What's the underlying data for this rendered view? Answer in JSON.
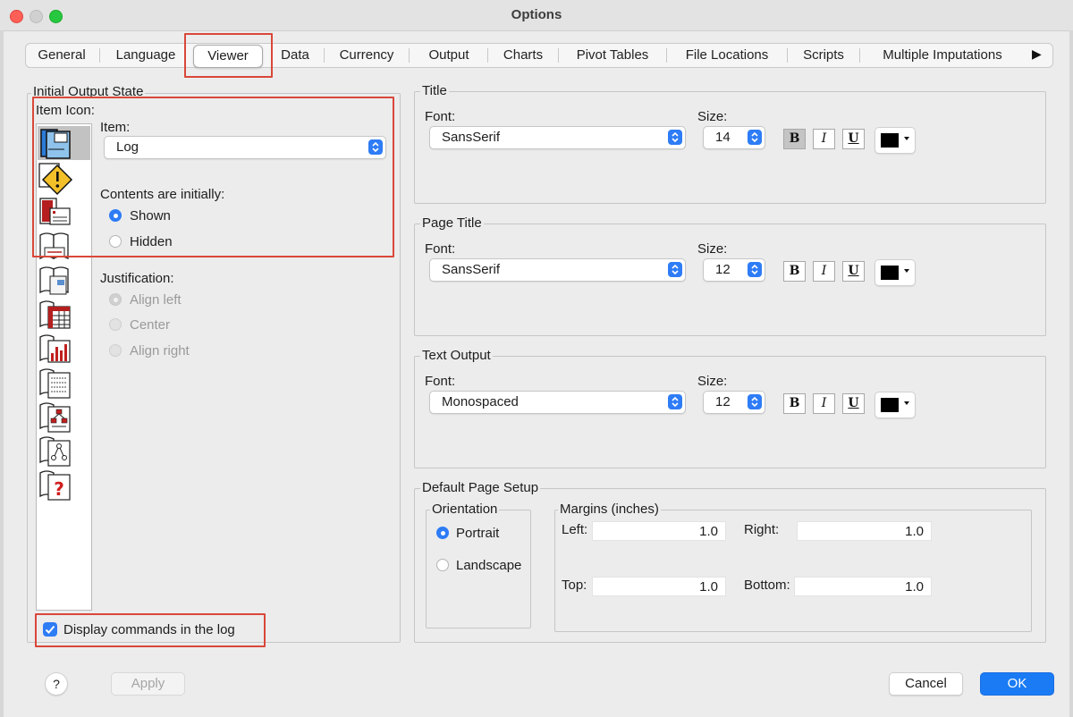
{
  "window": {
    "title": "Options"
  },
  "tabs": [
    "General",
    "Language",
    "Viewer",
    "Data",
    "Currency",
    "Output",
    "Charts",
    "Pivot Tables",
    "File Locations",
    "Scripts",
    "Multiple Imputations"
  ],
  "left": {
    "group_title": "Initial Output State",
    "item_icon_label": "Item Icon:",
    "item_label": "Item:",
    "item_value": "Log",
    "contents_label": "Contents are initially:",
    "shown": "Shown",
    "hidden": "Hidden",
    "justification_label": "Justification:",
    "align_left": "Align left",
    "center": "Center",
    "align_right": "Align right",
    "display_commands": "Display commands in the log",
    "icons": [
      "log-icon",
      "warning-icon",
      "notes-icon",
      "title-icon",
      "page-title-icon",
      "pivot-table-icon",
      "chart-icon",
      "text-output-icon",
      "tree-model-icon",
      "model-viewer-icon",
      "unknown-object-icon"
    ]
  },
  "title_section": {
    "label": "Title",
    "font_label": "Font:",
    "font": "SansSerif",
    "size_label": "Size:",
    "size": "14",
    "bold": "B",
    "italic": "I",
    "underline": "U",
    "color": "#000000"
  },
  "page_title_section": {
    "label": "Page Title",
    "font_label": "Font:",
    "font": "SansSerif",
    "size_label": "Size:",
    "size": "12",
    "bold": "B",
    "italic": "I",
    "underline": "U",
    "color": "#000000"
  },
  "text_output_section": {
    "label": "Text Output",
    "font_label": "Font:",
    "font": "Monospaced",
    "size_label": "Size:",
    "size": "12",
    "bold": "B",
    "italic": "I",
    "underline": "U",
    "color": "#000000"
  },
  "page_setup": {
    "label": "Default Page Setup",
    "orientation_label": "Orientation",
    "portrait": "Portrait",
    "landscape": "Landscape",
    "margins_label": "Margins (inches)",
    "left_label": "Left:",
    "left": "1.0",
    "right_label": "Right:",
    "right": "1.0",
    "top_label": "Top:",
    "top": "1.0",
    "bottom_label": "Bottom:",
    "bottom": "1.0"
  },
  "footer": {
    "help": "?",
    "apply": "Apply",
    "cancel": "Cancel",
    "ok": "OK"
  },
  "colors": {
    "accent": "#2e7cf6",
    "highlight_box": "#d9473a"
  }
}
